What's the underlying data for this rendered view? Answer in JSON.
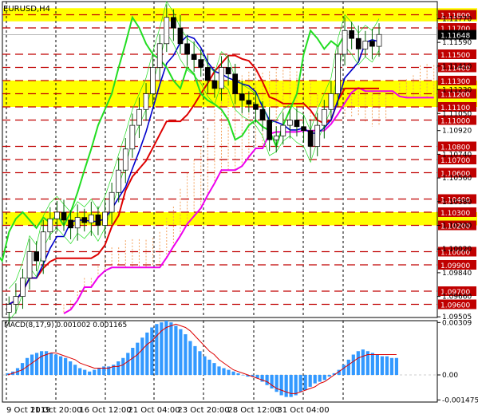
{
  "symbol_label": "EURUSD,H4",
  "macd_label": "MACD(8,17,9) 0.001002 0.001165",
  "colors": {
    "background": "#ffffff",
    "yellow_band": "#ffff00",
    "resistance_line": "#c00000",
    "candles": "#006400",
    "kijun": "#dd0000",
    "tenkan": "#0000cc",
    "chikou": "#22dd22",
    "senkou_b": "#ee00ee",
    "cloud": "#f4a460",
    "macd_hist": "#3399ff",
    "macd_signal": "#dd0000",
    "current_price_bg": "#000000"
  },
  "chart_data": [
    {
      "type": "candlestick",
      "title": "EURUSD,H4",
      "ylim": [
        1.095,
        1.119
      ],
      "price_axis_labels": [
        "1.11770",
        "1.11590",
        "1.11410",
        "1.11230",
        "1.11050",
        "1.10920",
        "1.10740",
        "1.10560",
        "1.10380",
        "1.10200",
        "1.10020",
        "1.09840",
        "1.09660",
        "1.09505"
      ],
      "x_tick_labels": [
        "9 Oct 2019",
        "11 Oct 20:00",
        "16 Oct 12:00",
        "21 Oct 04:00",
        "23 Oct 20:00",
        "28 Oct 12:00",
        "31 Oct 04:00"
      ],
      "current_price": "1.11648",
      "marked_levels": [
        "1.11800",
        "1.11700",
        "1.11500",
        "1.11400",
        "1.11300",
        "1.11200",
        "1.11100",
        "1.11000",
        "1.10800",
        "1.10700",
        "1.10600",
        "1.10400",
        "1.10300",
        "1.10200",
        "1.10000",
        "1.09900",
        "1.09700",
        "1.09600"
      ],
      "support_resistance_zones": [
        {
          "from": 1.1175,
          "to": 1.1185
        },
        {
          "from": 1.111,
          "to": 1.113
        },
        {
          "from": 1.102,
          "to": 1.103
        }
      ],
      "close_path": [
        1.096,
        1.0966,
        1.098,
        1.1,
        1.0993,
        1.1015,
        1.1025,
        1.103,
        1.1024,
        1.1018,
        1.1026,
        1.1022,
        1.1028,
        1.102,
        1.103,
        1.1045,
        1.1062,
        1.1078,
        1.1096,
        1.1108,
        1.112,
        1.114,
        1.1158,
        1.1178,
        1.117,
        1.1158,
        1.115,
        1.1146,
        1.114,
        1.113,
        1.1124,
        1.114,
        1.1135,
        1.112,
        1.1115,
        1.1112,
        1.1108,
        1.11,
        1.1085,
        1.1088,
        1.1096,
        1.11,
        1.1095,
        1.1092,
        1.108,
        1.1096,
        1.1108,
        1.112,
        1.115,
        1.1168,
        1.1162,
        1.1154,
        1.116,
        1.1156,
        1.1165
      ]
    },
    {
      "type": "bar",
      "title": "MACD(8,17,9) 0.001002 0.001165",
      "ylim": [
        -0.0016,
        0.0032
      ],
      "axis_labels": [
        "0.00309",
        "0.00",
        "-0.001475"
      ],
      "histogram": [
        0.0001,
        0.0002,
        0.0004,
        0.0007,
        0.001,
        0.0012,
        0.0013,
        0.0014,
        0.0014,
        0.0013,
        0.0012,
        0.0011,
        0.001,
        0.0008,
        0.0006,
        0.0004,
        0.0003,
        0.0002,
        0.0003,
        0.0004,
        0.0005,
        0.0005,
        0.0006,
        0.0008,
        0.001,
        0.0013,
        0.0016,
        0.0019,
        0.0022,
        0.0025,
        0.0028,
        0.003,
        0.0031,
        0.0032,
        0.0031,
        0.0029,
        0.0027,
        0.0024,
        0.002,
        0.0017,
        0.0014,
        0.0011,
        0.0009,
        0.0007,
        0.0005,
        0.0004,
        0.0003,
        0.0002,
        0.0001,
        0.0,
        -0.0001,
        -0.0001,
        -0.0002,
        -0.0004,
        -0.0006,
        -0.0008,
        -0.001,
        -0.0012,
        -0.0013,
        -0.0013,
        -0.0012,
        -0.001,
        -0.0009,
        -0.0007,
        -0.0005,
        -0.0004,
        -0.0003,
        -0.0001,
        0.0001,
        0.0003,
        0.0006,
        0.0009,
        0.0012,
        0.0014,
        0.0015,
        0.0014,
        0.0013,
        0.0012,
        0.0011,
        0.0011,
        0.001,
        0.001
      ],
      "signal": [
        0.0,
        0.0001,
        0.0002,
        0.0003,
        0.0005,
        0.0007,
        0.0009,
        0.0011,
        0.0012,
        0.0013,
        0.0013,
        0.0012,
        0.0011,
        0.001,
        0.0009,
        0.0007,
        0.0006,
        0.0005,
        0.0004,
        0.0004,
        0.0004,
        0.0004,
        0.0005,
        0.0005,
        0.0006,
        0.0008,
        0.001,
        0.0012,
        0.0015,
        0.0018,
        0.002,
        0.0023,
        0.0026,
        0.0028,
        0.0029,
        0.003,
        0.0029,
        0.0028,
        0.0026,
        0.0023,
        0.002,
        0.0017,
        0.0014,
        0.0012,
        0.0009,
        0.0007,
        0.0005,
        0.0003,
        0.0002,
        0.0001,
        0.0,
        -0.0001,
        -0.0002,
        -0.0003,
        -0.0004,
        -0.0006,
        -0.0008,
        -0.0009,
        -0.001,
        -0.0011,
        -0.0011,
        -0.001,
        -0.0009,
        -0.0008,
        -0.0007,
        -0.0005,
        -0.0004,
        -0.0002,
        0.0,
        0.0002,
        0.0004,
        0.0006,
        0.0008,
        0.001,
        0.0011,
        0.0012,
        0.0012,
        0.0012,
        0.0012,
        0.0012,
        0.0012,
        0.0012
      ]
    }
  ]
}
